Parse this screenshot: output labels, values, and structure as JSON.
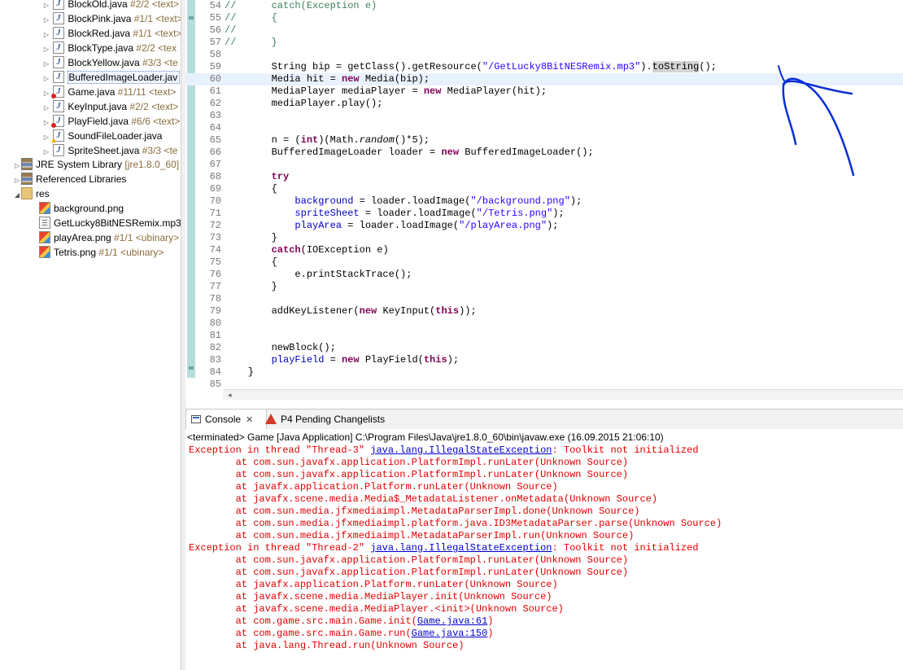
{
  "explorer": {
    "items": [
      {
        "name": "BlockOld.java",
        "deco": "#2/2 <text>",
        "icon": "java-file-icon"
      },
      {
        "name": "BlockPink.java",
        "deco": "#1/1 <text>",
        "icon": "java-file-icon"
      },
      {
        "name": "BlockRed.java",
        "deco": "#1/1 <text>",
        "icon": "java-file-icon"
      },
      {
        "name": "BlockType.java",
        "deco": "#2/2 <tex",
        "icon": "java-file-icon"
      },
      {
        "name": "BlockYellow.java",
        "deco": "#3/3 <te",
        "icon": "java-file-icon"
      },
      {
        "name": "BufferedImageLoader.jav",
        "deco": "",
        "icon": "java-file-icon"
      },
      {
        "name": "Game.java",
        "deco": "#11/11 <text>",
        "icon": "java-file-error-icon"
      },
      {
        "name": "KeyInput.java",
        "deco": "#2/2 <text>",
        "icon": "java-file-icon"
      },
      {
        "name": "PlayField.java",
        "deco": "#6/6 <text>",
        "icon": "java-file-error-icon"
      },
      {
        "name": "SoundFileLoader.java",
        "deco": "",
        "icon": "java-file-warning-icon"
      },
      {
        "name": "SpriteSheet.java",
        "deco": "#3/3 <te",
        "icon": "java-file-icon"
      }
    ],
    "jre": {
      "name": "JRE System Library",
      "deco": "[jre1.8.0_60]"
    },
    "referenced": {
      "name": "Referenced Libraries"
    },
    "res": {
      "name": "res"
    },
    "res_items": [
      {
        "name": "background.png",
        "deco": ""
      },
      {
        "name": "GetLucky8BitNESRemix.mp3",
        "deco": ""
      },
      {
        "name": "playArea.png",
        "deco": "#1/1 <ubinary>"
      },
      {
        "name": "Tetris.png",
        "deco": "#1/1 <ubinary>"
      }
    ]
  },
  "editor": {
    "lines": [
      {
        "n": "54",
        "html": "<span class=\"cmt\">//      catch(Exception e)</span>"
      },
      {
        "n": "55",
        "html": "<span class=\"cmt\">//      {</span>"
      },
      {
        "n": "56",
        "html": "<span class=\"cmt\">//</span>"
      },
      {
        "n": "57",
        "html": "<span class=\"cmt\">//      }</span>"
      },
      {
        "n": "58",
        "html": ""
      },
      {
        "n": "59",
        "html": "        String bip = getClass().getResource(<span class=\"str\">\"/GetLucky8BitNESRemix.mp3\"</span>).<span class=\"hl\">toString</span>();"
      },
      {
        "n": "60",
        "html": "        Media hit = <span class=\"kw\">new</span> Media(bip);"
      },
      {
        "n": "61",
        "html": "        MediaPlayer mediaPlayer = <span class=\"kw\">new</span> MediaPlayer(hit);"
      },
      {
        "n": "62",
        "html": "        mediaPlayer.play();"
      },
      {
        "n": "63",
        "html": ""
      },
      {
        "n": "64",
        "html": ""
      },
      {
        "n": "65",
        "html": "        n = (<span class=\"kw\">int</span>)(Math.<span class=\"st\">random</span>()*5);"
      },
      {
        "n": "66",
        "html": "        BufferedImageLoader loader = <span class=\"kw\">new</span> BufferedImageLoader();"
      },
      {
        "n": "67",
        "html": ""
      },
      {
        "n": "68",
        "html": "        <span class=\"kw\">try</span>"
      },
      {
        "n": "69",
        "html": "        {"
      },
      {
        "n": "70",
        "html": "            <span class=\"fld\">background</span> = loader.loadImage(<span class=\"str\">\"/background.png\"</span>);"
      },
      {
        "n": "71",
        "html": "            <span class=\"fld\">spriteSheet</span> = loader.loadImage(<span class=\"str\">\"/Tetris.png\"</span>);"
      },
      {
        "n": "72",
        "html": "            <span class=\"fld\">playArea</span> = loader.loadImage(<span class=\"str\">\"/playArea.png\"</span>);"
      },
      {
        "n": "73",
        "html": "        }"
      },
      {
        "n": "74",
        "html": "        <span class=\"kw\">catch</span>(IOException e)"
      },
      {
        "n": "75",
        "html": "        {"
      },
      {
        "n": "76",
        "html": "            e.printStackTrace();"
      },
      {
        "n": "77",
        "html": "        }"
      },
      {
        "n": "78",
        "html": ""
      },
      {
        "n": "79",
        "html": "        addKeyListener(<span class=\"kw\">new</span> KeyInput(<span class=\"kw\">this</span>));"
      },
      {
        "n": "80",
        "html": ""
      },
      {
        "n": "81",
        "html": ""
      },
      {
        "n": "82",
        "html": "        newBlock();"
      },
      {
        "n": "83",
        "html": "        <span class=\"fld\">playField</span> = <span class=\"kw\">new</span> PlayField(<span class=\"kw\">this</span>);"
      },
      {
        "n": "84",
        "html": "    }"
      },
      {
        "n": "85",
        "html": ""
      }
    ]
  },
  "console": {
    "tabs": {
      "console": "Console",
      "pending": "P4 Pending Changelists"
    },
    "terminated": "<terminated> Game [Java Application] C:\\Program Files\\Java\\jre1.8.0_60\\bin\\javaw.exe (16.09.2015 21:06:10)",
    "lines": [
      {
        "pre": "Exception in thread \"Thread-3\" ",
        "link": "java.lang.IllegalStateException",
        "post": ": Toolkit not initialized"
      },
      {
        "pre": "        at com.sun.javafx.application.PlatformImpl.runLater(Unknown Source)"
      },
      {
        "pre": "        at com.sun.javafx.application.PlatformImpl.runLater(Unknown Source)"
      },
      {
        "pre": "        at javafx.application.Platform.runLater(Unknown Source)"
      },
      {
        "pre": "        at javafx.scene.media.Media$_MetadataListener.onMetadata(Unknown Source)"
      },
      {
        "pre": "        at com.sun.media.jfxmediaimpl.MetadataParserImpl.done(Unknown Source)"
      },
      {
        "pre": "        at com.sun.media.jfxmediaimpl.platform.java.ID3MetadataParser.parse(Unknown Source)"
      },
      {
        "pre": "        at com.sun.media.jfxmediaimpl.MetadataParserImpl.run(Unknown Source)"
      },
      {
        "pre": "Exception in thread \"Thread-2\" ",
        "link": "java.lang.IllegalStateException",
        "post": ": Toolkit not initialized"
      },
      {
        "pre": "        at com.sun.javafx.application.PlatformImpl.runLater(Unknown Source)"
      },
      {
        "pre": "        at com.sun.javafx.application.PlatformImpl.runLater(Unknown Source)"
      },
      {
        "pre": "        at javafx.application.Platform.runLater(Unknown Source)"
      },
      {
        "pre": "        at javafx.scene.media.MediaPlayer.init(Unknown Source)"
      },
      {
        "pre": "        at javafx.scene.media.MediaPlayer.<init>(Unknown Source)"
      },
      {
        "pre": "        at com.game.src.main.Game.init(",
        "link": "Game.java:61",
        "post": ")"
      },
      {
        "pre": "        at com.game.src.main.Game.run(",
        "link": "Game.java:150",
        "post": ")"
      },
      {
        "pre": "        at java.lang.Thread.run(Unknown Source)"
      }
    ]
  }
}
